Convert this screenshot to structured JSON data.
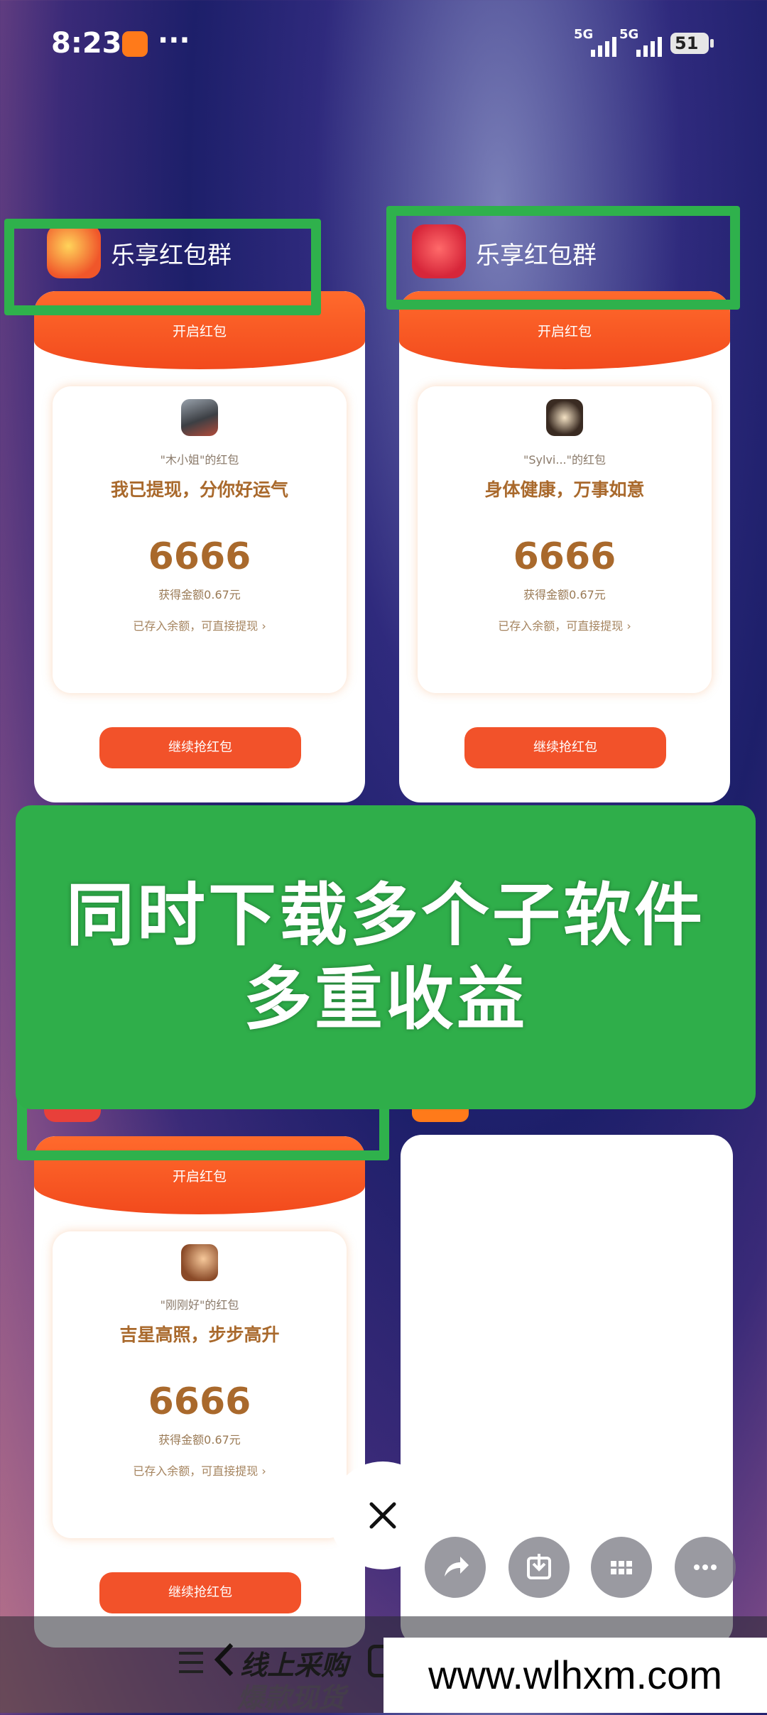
{
  "status_bar": {
    "time": "8:23",
    "more": "···",
    "network_1": "5G",
    "network_2": "5G",
    "battery": "51"
  },
  "cards": [
    {
      "app_name": "乐享红包群",
      "banner_title": "开启红包",
      "from": "\"木小姐\"的红包",
      "wish": "我已提现，分你好运气",
      "amount": "6666",
      "amount_sub": "获得金额0.67元",
      "saved": "已存入余额，可直接提现 ›",
      "button": "继续抢红包"
    },
    {
      "app_name": "乐享红包群",
      "banner_title": "开启红包",
      "from": "\"Sylvi...\"的红包",
      "wish": "身体健康，万事如意",
      "amount": "6666",
      "amount_sub": "获得金额0.67元",
      "saved": "已存入余额，可直接提现 ›",
      "button": "继续抢红包"
    },
    {
      "app_name": "",
      "banner_title": "开启红包",
      "from": "\"刚刚好\"的红包",
      "wish": "吉星高照，步步高升",
      "amount": "6666",
      "amount_sub": "获得金额0.67元",
      "saved": "已存入余额，可直接提现 ›",
      "button": "继续抢红包"
    }
  ],
  "overlay_banner": {
    "line1": "同时下载多个子软件",
    "line2": "多重收益"
  },
  "bottom_actions": [
    "share-icon",
    "download-icon",
    "apps-grid-icon",
    "more-icon"
  ],
  "nav": {
    "ad_line1": "线上采购",
    "ad_line2": "爆款现货"
  },
  "watermark": "www.wlhxm.com",
  "colors": {
    "accent_red": "#f2522a",
    "gold_text": "#a9692c",
    "green": "#2fb14c"
  }
}
